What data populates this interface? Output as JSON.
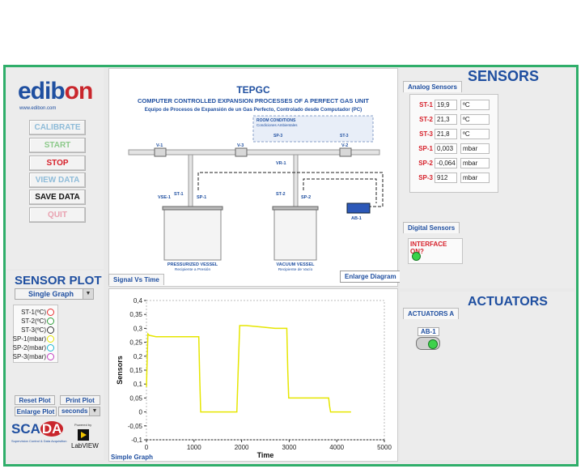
{
  "logo": {
    "text_a": "edib",
    "text_b": "on",
    "url": "www.edibon.com"
  },
  "buttons": {
    "calibrate": "CALIBRATE",
    "start": "START",
    "stop": "STOP",
    "view_data": "VIEW DATA",
    "save_data": "SAVE DATA",
    "quit": "QUIT"
  },
  "diagram": {
    "title": "TEPGC",
    "subtitle": "COMPUTER CONTROLLED EXPANSION PROCESSES OF A PERFECT GAS UNIT",
    "subtitle_es": "Equipo de Procesos de Expansión de un Gas Perfecto, Controlado desde Computador (PC)",
    "room_conditions": "ROOM CONDITIONS",
    "room_conditions_es": "Condiciones Ambientales",
    "labels": {
      "v1": "V-1",
      "v2": "V-2",
      "v3": "V-3",
      "vr1": "VR-1",
      "vse1": "VSE-1",
      "st1": "ST-1",
      "sp1": "SP-1",
      "st2": "ST-2",
      "sp2": "SP-2",
      "st3": "ST-3",
      "sp3": "SP-3",
      "ab1": "AB-1"
    },
    "vessel1": "PRESSURIZED VESSEL",
    "vessel1_es": "Recipiente a Presión",
    "vessel2": "VACUUM VESSEL",
    "vessel2_es": "Recipiente de Vacío"
  },
  "tabs": {
    "signal_vs_time": "Signal Vs Time",
    "enlarge_diagram": "Enlarge Diagram"
  },
  "sensor_plot": {
    "title": "SENSOR PLOT",
    "mode": "Single Graph",
    "legend": [
      {
        "label": "ST-1(ºC)",
        "color": "#e83030"
      },
      {
        "label": "ST-2(ºC)",
        "color": "#2e9e3a"
      },
      {
        "label": "ST-3(ºC)",
        "color": "#333333"
      },
      {
        "label": "SP-1(mbar)",
        "color": "#e6e600"
      },
      {
        "label": "SP-2(mbar)",
        "color": "#20b8d0"
      },
      {
        "label": "SP-3(mbar)",
        "color": "#c040c0"
      }
    ],
    "reset_plot": "Reset Plot",
    "print_plot": "Print Plot",
    "enlarge_plot": "Enlarge Plot",
    "time_unit": "seconds"
  },
  "scada": {
    "text_a": "SCA",
    "text_b": "DA",
    "subtitle": "Supervision Control & Data Acquisition",
    "powered": "Powered by",
    "labview": "LabVIEW"
  },
  "sensors": {
    "title": "SENSORS",
    "analog_tab": "Analog Sensors",
    "rows": [
      {
        "id": "ST-1",
        "value": "19,9",
        "unit": "ºC"
      },
      {
        "id": "ST-2",
        "value": "21,3",
        "unit": "ºC"
      },
      {
        "id": "ST-3",
        "value": "21,8",
        "unit": "ºC"
      },
      {
        "id": "SP-1",
        "value": "0,003",
        "unit": "mbar"
      },
      {
        "id": "SP-2",
        "value": "-0,064",
        "unit": "mbar"
      },
      {
        "id": "SP-3",
        "value": "912",
        "unit": "mbar"
      }
    ],
    "digital_tab": "Digital Sensors",
    "interface_label": "INTERFACE ON?"
  },
  "actuators": {
    "title": "ACTUATORS",
    "tab": "ACTUATORS A",
    "ab1": "AB-1"
  },
  "chart_data": {
    "type": "line",
    "title": "",
    "xlabel": "Time",
    "ylabel": "Sensors",
    "xlim": [
      0,
      5000
    ],
    "ylim": [
      -0.1,
      0.4
    ],
    "xticks": [
      "0",
      "1000",
      "2000",
      "3000",
      "4000",
      "5000"
    ],
    "yticks": [
      "-0,1",
      "-0,05",
      "0",
      "0,05",
      "0,1",
      "0,15",
      "0,2",
      "0,25",
      "0,3",
      "0,35",
      "0,4"
    ],
    "footer": "Simple Graph",
    "series": [
      {
        "name": "SP-1(mbar)",
        "color": "#e6e600",
        "x": [
          0,
          30,
          60,
          200,
          400,
          700,
          1000,
          1100,
          1120,
          1140,
          1200,
          1500,
          1800,
          1900,
          1930,
          1960,
          2100,
          2400,
          2700,
          2950,
          2970,
          2990,
          3100,
          3400,
          3700,
          3830,
          3850,
          3870,
          4000,
          4250,
          4300
        ],
        "y": [
          0.09,
          0.28,
          0.275,
          0.27,
          0.27,
          0.27,
          0.27,
          0.27,
          0.12,
          0.0,
          0.0,
          0.0,
          0.0,
          0.0,
          0.16,
          0.31,
          0.31,
          0.305,
          0.3,
          0.3,
          0.15,
          0.05,
          0.05,
          0.05,
          0.05,
          0.05,
          0.02,
          0.0,
          0.0,
          0.0,
          0.0
        ]
      }
    ]
  }
}
